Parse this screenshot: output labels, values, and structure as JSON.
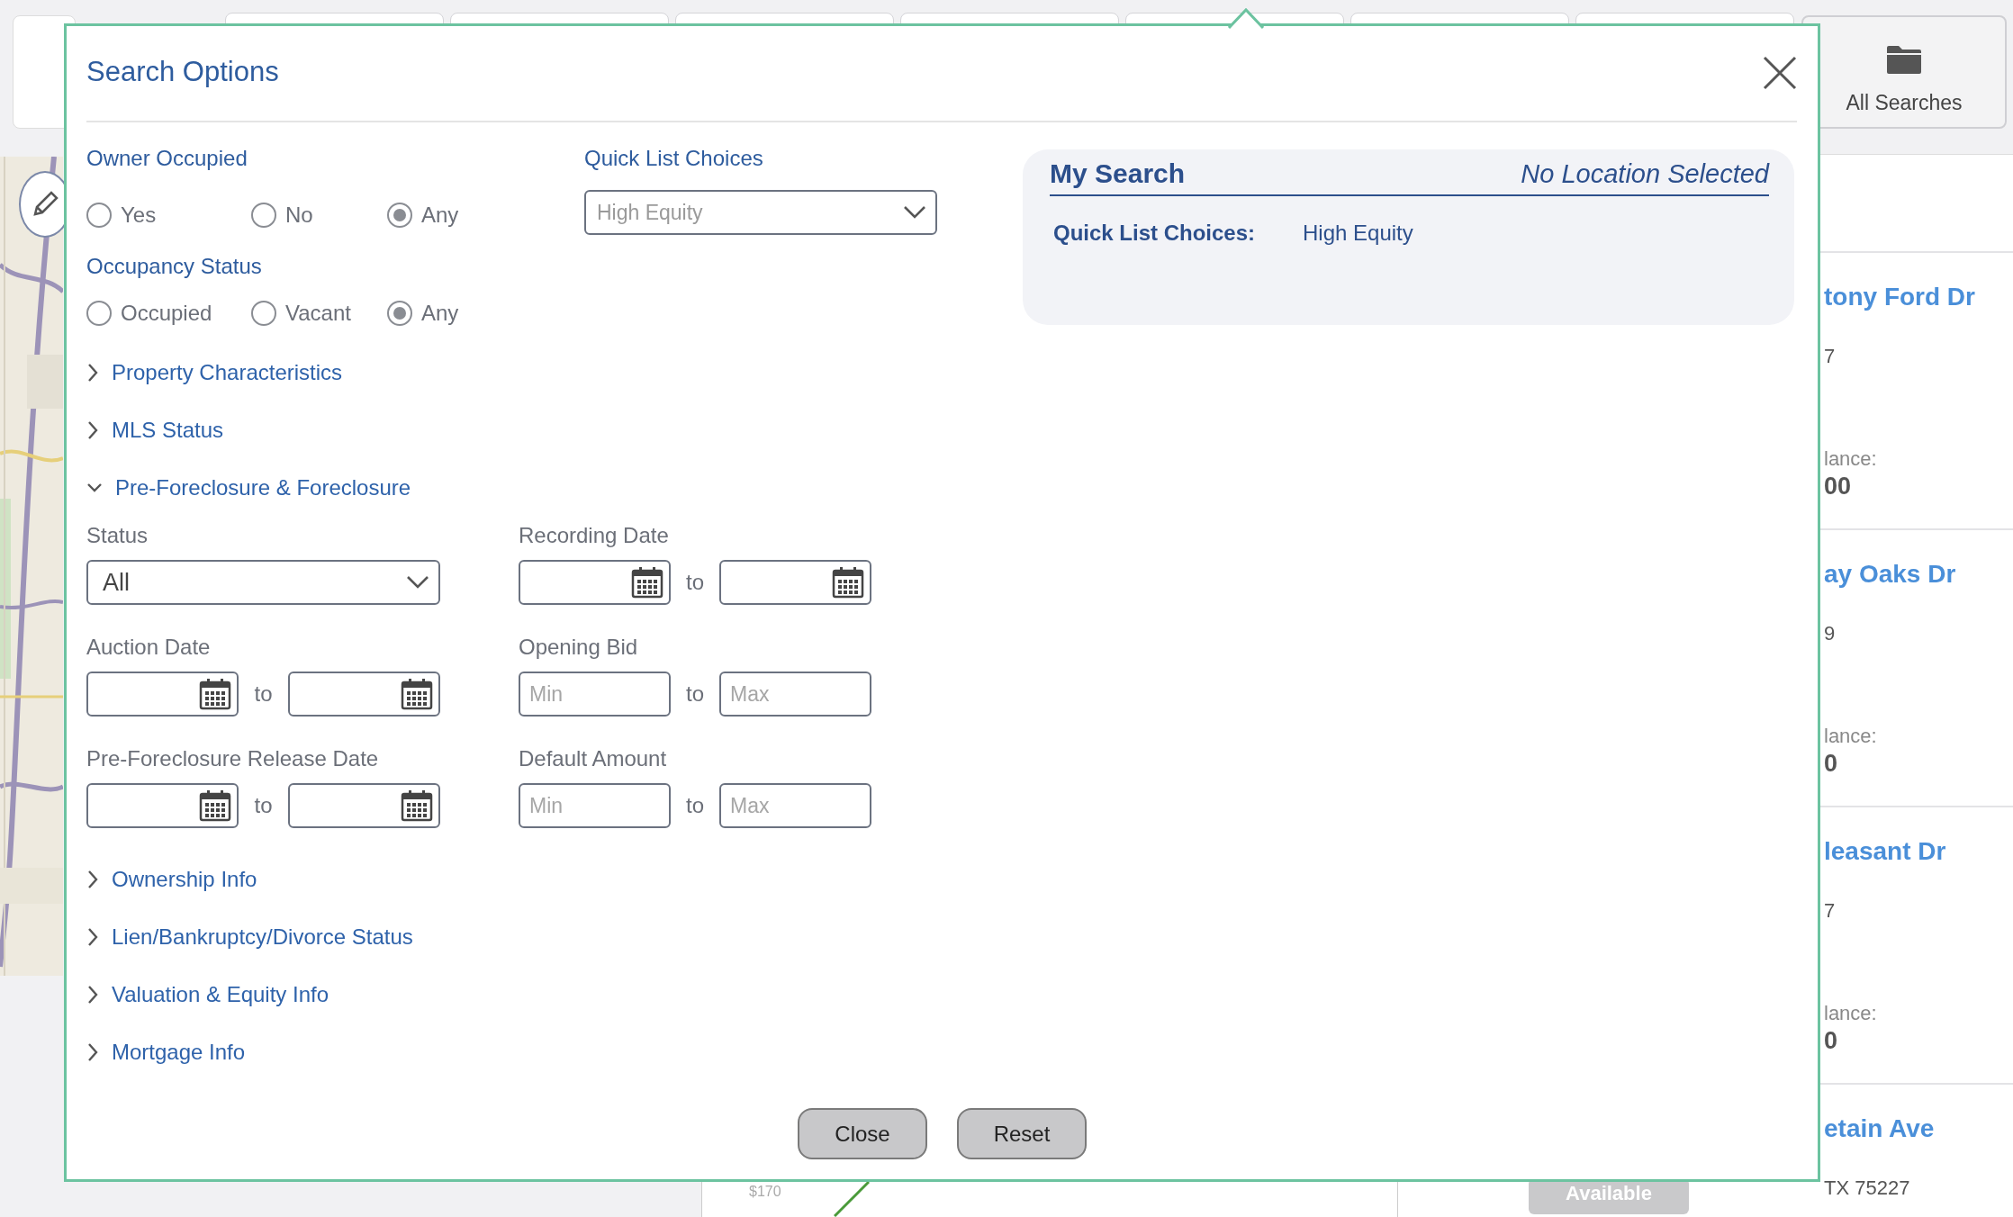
{
  "dialog": {
    "title": "Search Options",
    "owner_occupied": {
      "label": "Owner Occupied",
      "options": [
        {
          "label": "Yes",
          "selected": false
        },
        {
          "label": "No",
          "selected": false
        },
        {
          "label": "Any",
          "selected": true
        }
      ]
    },
    "occupancy_status": {
      "label": "Occupancy Status",
      "options": [
        {
          "label": "Occupied",
          "selected": false
        },
        {
          "label": "Vacant",
          "selected": false
        },
        {
          "label": "Any",
          "selected": true
        }
      ]
    },
    "quick_list": {
      "label": "Quick List Choices",
      "value": "High Equity"
    },
    "my_search": {
      "title": "My Search",
      "location": "No Location Selected",
      "rows": [
        {
          "label": "Quick List Choices:",
          "value": "High Equity"
        }
      ]
    },
    "sections": [
      {
        "label": "Property Characteristics",
        "expanded": false
      },
      {
        "label": "MLS Status",
        "expanded": false
      },
      {
        "label": "Pre-Foreclosure & Foreclosure",
        "expanded": true,
        "fields": [
          {
            "kind": "select",
            "label": "Status",
            "value": "All"
          },
          {
            "kind": "date_range",
            "label": "Recording Date",
            "separator": "to"
          },
          {
            "kind": "date_range",
            "label": "Auction Date",
            "separator": "to"
          },
          {
            "kind": "number_range",
            "label": "Opening Bid",
            "separator": "to",
            "min_placeholder": "Min",
            "max_placeholder": "Max"
          },
          {
            "kind": "date_range",
            "label": "Pre-Foreclosure Release Date",
            "separator": "to"
          },
          {
            "kind": "number_range",
            "label": "Default Amount",
            "separator": "to",
            "min_placeholder": "Min",
            "max_placeholder": "Max"
          }
        ]
      },
      {
        "label": "Ownership Info",
        "expanded": false
      },
      {
        "label": "Lien/Bankruptcy/Divorce Status",
        "expanded": false
      },
      {
        "label": "Valuation & Equity Info",
        "expanded": false
      },
      {
        "label": "Mortgage Info",
        "expanded": false
      }
    ],
    "buttons": [
      "Close",
      "Reset"
    ]
  },
  "all_searches": {
    "label": "All Searches"
  },
  "results": [
    {
      "street": "tony Ford Dr",
      "line_2": "7",
      "balance_label": "lance:",
      "balance": "00"
    },
    {
      "street": "ay Oaks Dr",
      "line_2": "9",
      "balance_label": "lance:",
      "balance": "0"
    },
    {
      "street": "leasant Dr",
      "line_2": "7",
      "balance_label": "lance:",
      "balance": "0"
    },
    {
      "street": "etain Ave",
      "line_2": "TX 75227",
      "badge": "Available"
    }
  ],
  "chart_axis_label": "$170"
}
